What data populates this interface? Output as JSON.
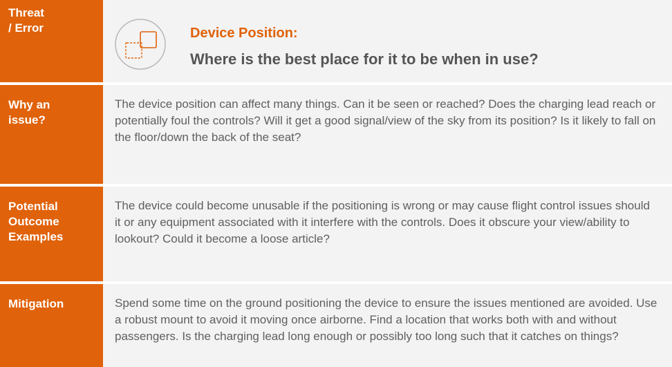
{
  "header": {
    "label": "Threat\n/ Error",
    "title": "Device Position:",
    "subtitle": "Where is the best place for it to be when in use?",
    "icon": "device-position-icon"
  },
  "rows": [
    {
      "label": "Why an\nissue?",
      "text": "The device position can affect many things. Can it be seen or reached? Does the charging lead reach or potentially foul the controls? Will it get a good signal/view of the sky from its position? Is it likely to fall on the floor/down the back of the seat?"
    },
    {
      "label": "Potential\nOutcome\nExamples",
      "text": "The device could become unusable if the positioning is wrong or may cause flight control issues should it or any equipment associated with it interfere with the controls. Does it obscure your view/ability to lookout? Could it become a loose article?"
    },
    {
      "label": "Mitigation",
      "text": "Spend some time on the ground positioning the device to ensure the issues mentioned are avoided. Use a robust mount to avoid it moving once airborne. Find a location that works both with and without passengers. Is the charging lead long enough or possibly too long such that it catches on things?"
    }
  ],
  "colors": {
    "accent": "#e0620a",
    "text": "#5f5f5f",
    "background": "#f3f3f3"
  }
}
